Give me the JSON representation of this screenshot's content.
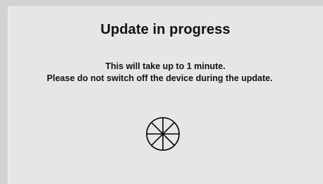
{
  "dialog": {
    "title": "Update in progress",
    "message_line1": "This will take up to 1 minute.",
    "message_line2": "Please do not switch off the device during the update."
  },
  "icons": {
    "spinner": "loading-wheel-icon"
  },
  "colors": {
    "background": "#d2d2d2",
    "panel": "#e6e6e6",
    "text": "#111111"
  }
}
